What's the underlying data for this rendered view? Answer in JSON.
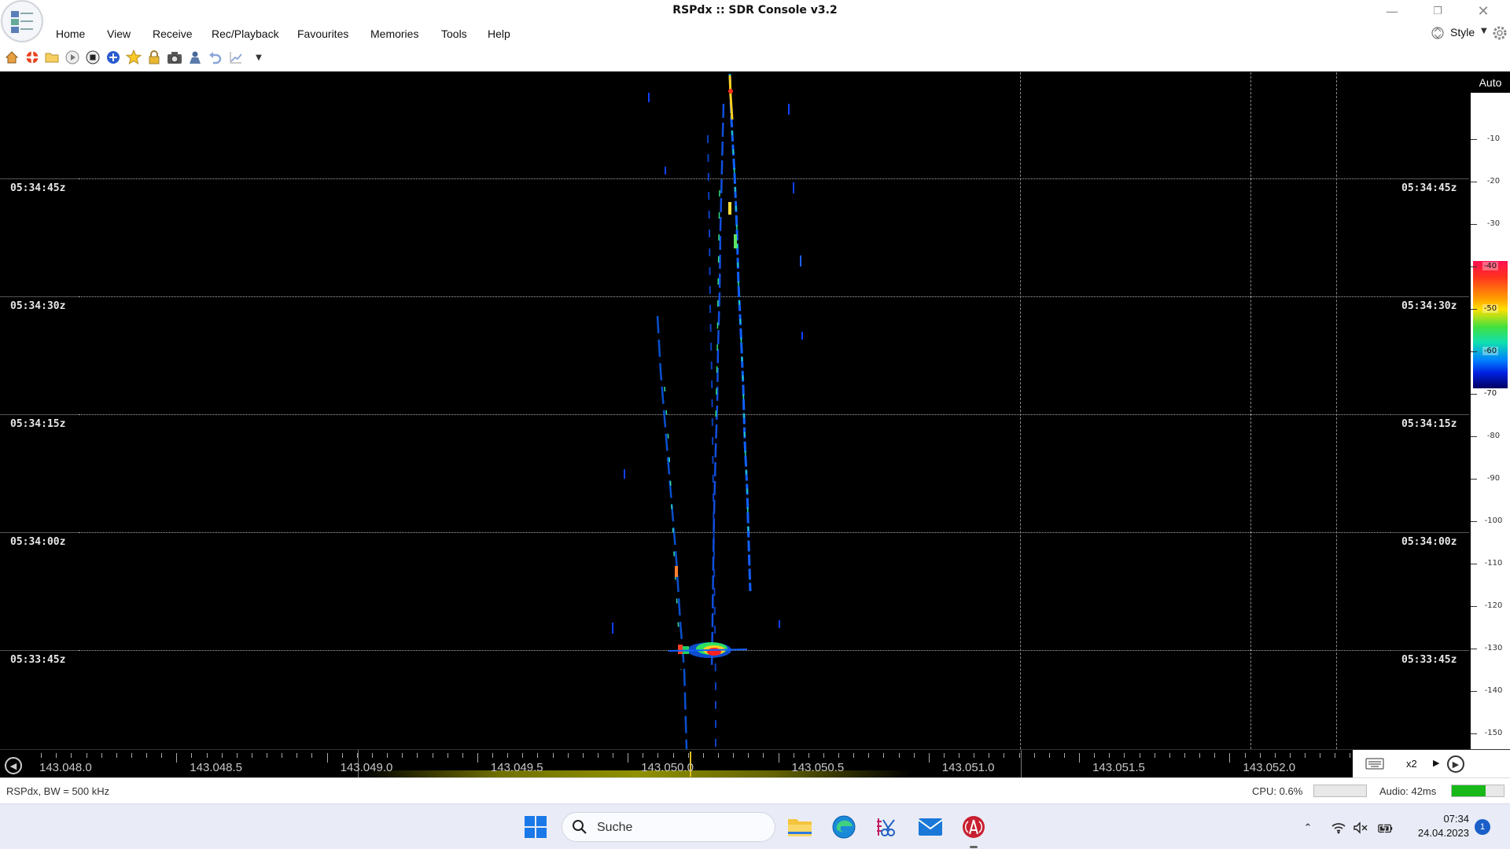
{
  "window": {
    "title": "RSPdx :: SDR Console v3.2"
  },
  "menu": {
    "items": [
      "Home",
      "View",
      "Receive",
      "Rec/Playback",
      "Favourites",
      "Memories",
      "Tools",
      "Help"
    ],
    "style_label": "Style"
  },
  "quick_access": {
    "icons": [
      "home-icon",
      "lifebuoy-icon",
      "folder-icon",
      "play-icon",
      "stop-icon",
      "add-circle-icon",
      "star-icon",
      "lock-icon",
      "camera-icon",
      "person-icon",
      "undo-icon",
      "graph-icon",
      "dropdown-arrow-icon"
    ]
  },
  "waterfall": {
    "time_labels": [
      "05:34:45z",
      "05:34:30z",
      "05:34:15z",
      "05:34:00z",
      "05:33:45z"
    ],
    "scale": {
      "auto_label": "Auto",
      "ticks": [
        "-10",
        "-20",
        "-30",
        "-40",
        "-50",
        "-60",
        "-70",
        "-80",
        "-90",
        "-100",
        "-110",
        "-120",
        "-130",
        "-140",
        "-150"
      ]
    }
  },
  "ruler": {
    "frequencies": [
      "143.048.0",
      "143.048.5",
      "143.049.0",
      "143.049.5",
      "143.050.0",
      "143.050.5",
      "143.051.0",
      "143.051.5",
      "143.052.0"
    ],
    "zoom_label": "x2"
  },
  "status": {
    "device_info": "RSPdx, BW = 500 kHz",
    "cpu": "CPU: 0.6%",
    "audio": "Audio: 42ms",
    "audio_level": 0.65
  },
  "taskbar": {
    "search_placeholder": "Suche",
    "time": "07:34",
    "date": "24.04.2023",
    "notification_count": "1"
  }
}
